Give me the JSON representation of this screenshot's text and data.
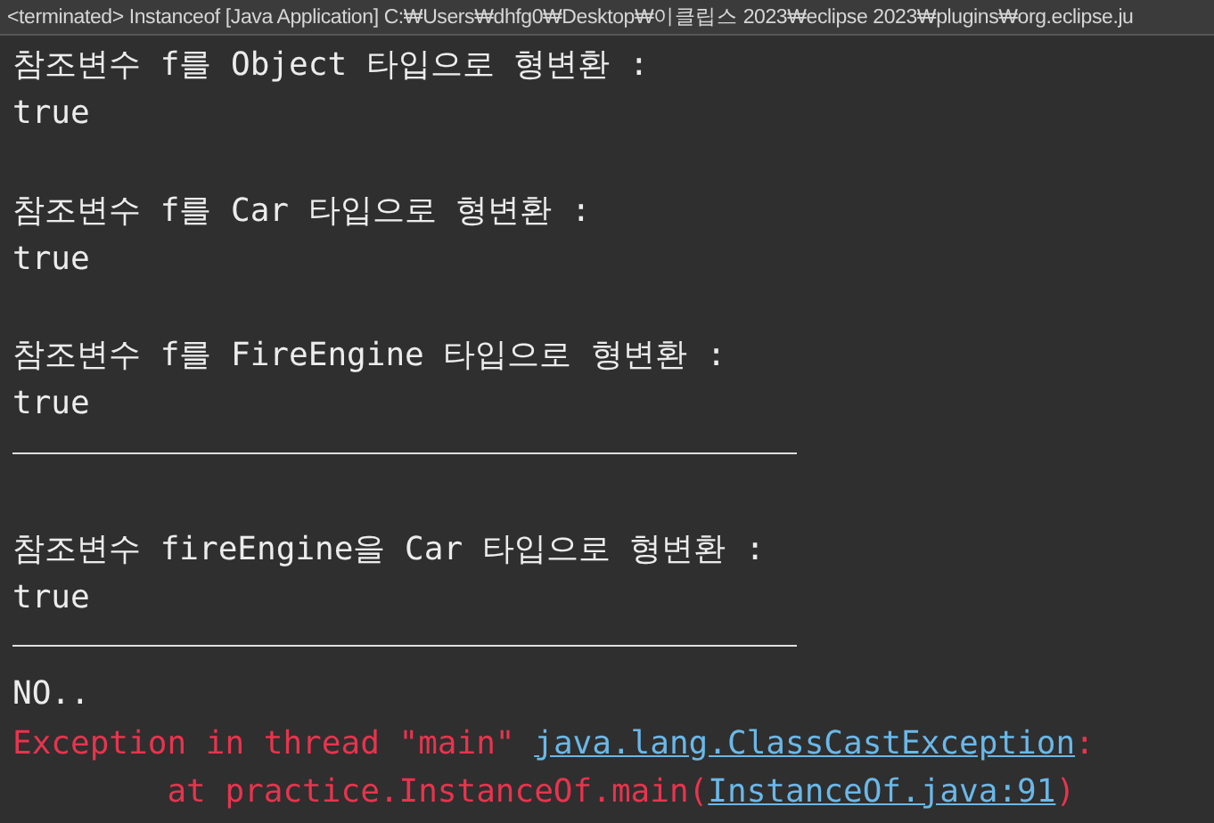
{
  "title_bar": "<terminated> Instanceof [Java Application] C:₩Users₩dhfg0₩Desktop₩이클립스 2023₩eclipse 2023₩plugins₩org.eclipse.ju",
  "lines": [
    {
      "kind": "out",
      "text": "참조변수 f를 Object 타입으로 형변환 :"
    },
    {
      "kind": "out",
      "text": "true"
    },
    {
      "kind": "blank"
    },
    {
      "kind": "out",
      "text": "참조변수 f를 Car 타입으로 형변환 :"
    },
    {
      "kind": "out",
      "text": "true"
    },
    {
      "kind": "blank"
    },
    {
      "kind": "out",
      "text": "참조변수 f를 FireEngine 타입으로 형변환 :"
    },
    {
      "kind": "out",
      "text": "true"
    },
    {
      "kind": "rule"
    },
    {
      "kind": "blank"
    },
    {
      "kind": "out",
      "text": "참조변수 fireEngine을 Car 타입으로 형변환 :"
    },
    {
      "kind": "out",
      "text": "true"
    },
    {
      "kind": "rule"
    },
    {
      "kind": "out",
      "text": "NO.."
    },
    {
      "kind": "error",
      "parts": [
        {
          "kind": "text",
          "text": "Exception in thread \"main\" "
        },
        {
          "kind": "link",
          "text": "java.lang.ClassCastException"
        },
        {
          "kind": "text",
          "text": ":"
        }
      ]
    },
    {
      "kind": "error",
      "parts": [
        {
          "kind": "text",
          "text": "        at practice.InstanceOf.main("
        },
        {
          "kind": "link",
          "text": "InstanceOf.java:91"
        },
        {
          "kind": "text",
          "text": ")"
        }
      ]
    }
  ]
}
